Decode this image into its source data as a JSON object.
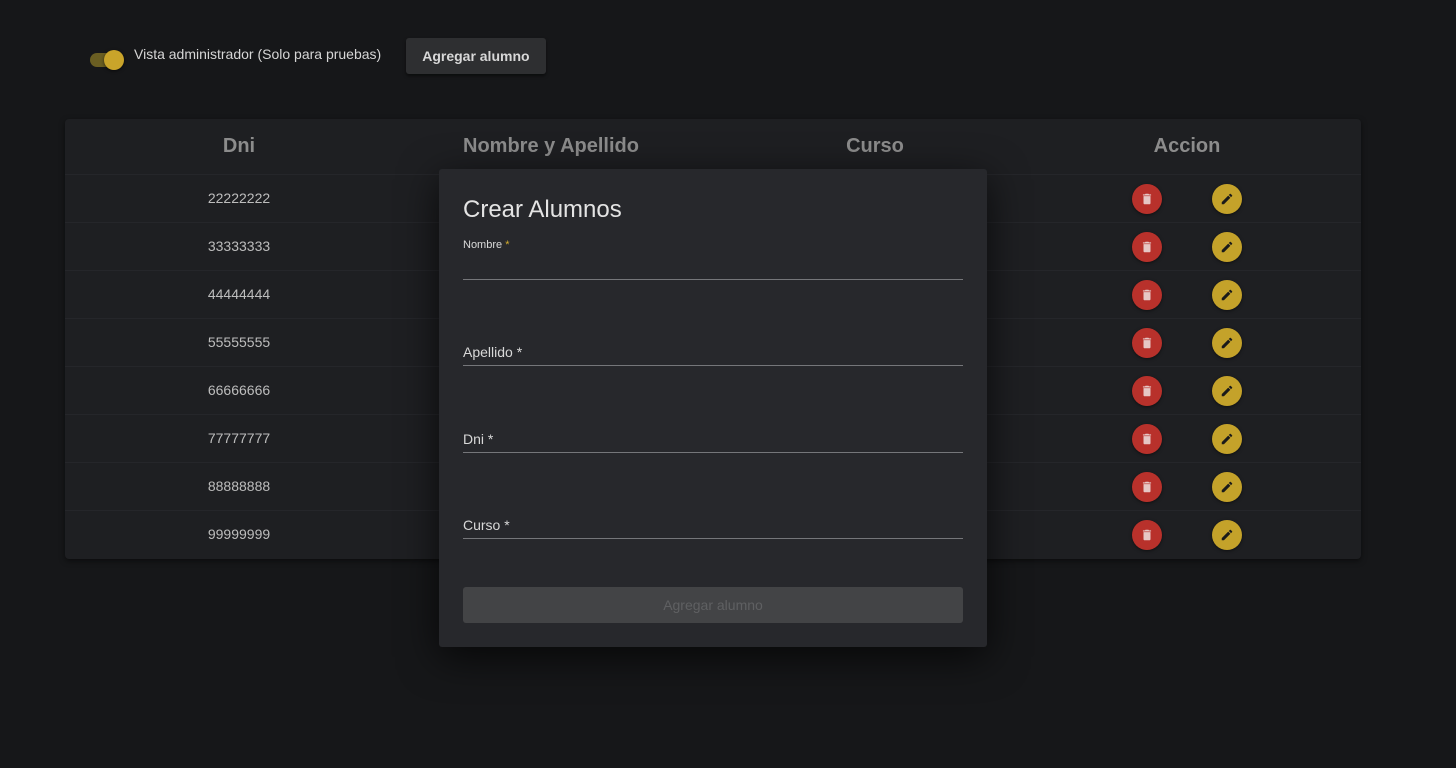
{
  "topbar": {
    "toggle_label": "Vista administrador (Solo para pruebas)",
    "toggle_on": true,
    "add_button_label": "Agregar alumno"
  },
  "table": {
    "headers": [
      "Dni",
      "Nombre y Apellido",
      "Curso",
      "Accion"
    ],
    "rows": [
      {
        "dni": "22222222"
      },
      {
        "dni": "33333333"
      },
      {
        "dni": "44444444"
      },
      {
        "dni": "55555555"
      },
      {
        "dni": "66666666"
      },
      {
        "dni": "77777777"
      },
      {
        "dni": "88888888"
      },
      {
        "dni": "99999999"
      }
    ],
    "actions": {
      "delete_icon": "trash-icon",
      "edit_icon": "pencil-icon"
    }
  },
  "dialog": {
    "title": "Crear Alumnos",
    "fields": [
      {
        "label": "Nombre",
        "required_mark": "*",
        "value": ""
      },
      {
        "label": "Apellido",
        "required_mark": "*",
        "value": ""
      },
      {
        "label": "Dni",
        "required_mark": "*",
        "value": ""
      },
      {
        "label": "Curso",
        "required_mark": "*",
        "value": ""
      }
    ],
    "submit_label": "Agregar alumno"
  },
  "colors": {
    "background": "#161719",
    "card": "#1e1f22",
    "dialog": "#27282c",
    "accent_gold": "#c9a42a",
    "delete_red": "#b8312b",
    "edit_gold": "#c4a22a"
  }
}
